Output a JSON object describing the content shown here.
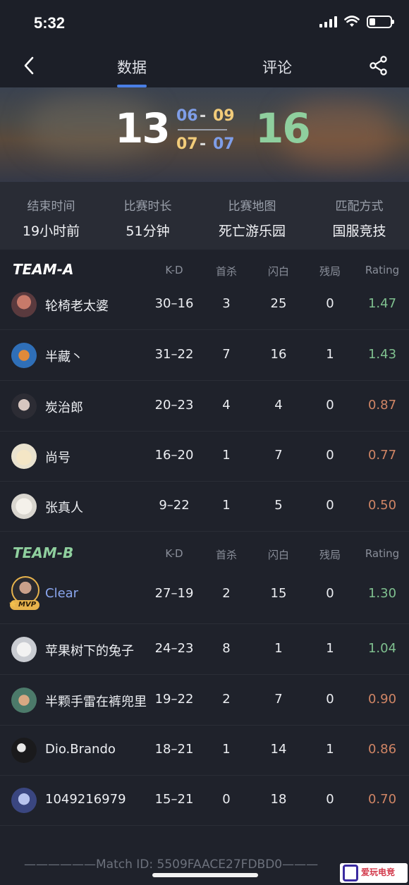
{
  "status": {
    "time": "5:32"
  },
  "nav": {
    "tab_data": "数据",
    "tab_comment": "评论"
  },
  "score": {
    "left": "13",
    "right": "16",
    "half1": {
      "a": "06",
      "sep": "-",
      "b": "09"
    },
    "half2": {
      "a": "07",
      "sep": "-",
      "b": "07"
    }
  },
  "info": [
    {
      "label": "结束时间",
      "value": "19小时前"
    },
    {
      "label": "比赛时长",
      "value": "51分钟"
    },
    {
      "label": "比赛地图",
      "value": "死亡游乐园"
    },
    {
      "label": "匹配方式",
      "value": "国服竞技"
    }
  ],
  "columns": {
    "kd": "K-D",
    "first_kill": "首杀",
    "flash": "闪白",
    "clutch": "残局",
    "rating": "Rating"
  },
  "team_a": {
    "name": "TEAM-A",
    "players": [
      {
        "name": "轮椅老太婆",
        "kd": "30–16",
        "first_kill": "3",
        "flash": "25",
        "clutch": "0",
        "rating": "1.47",
        "rating_color": "#7fc08f"
      },
      {
        "name": "半藏丶",
        "kd": "31–22",
        "first_kill": "7",
        "flash": "16",
        "clutch": "1",
        "rating": "1.43",
        "rating_color": "#7fc08f"
      },
      {
        "name": "炭治郎",
        "kd": "20–23",
        "first_kill": "4",
        "flash": "4",
        "clutch": "0",
        "rating": "0.87",
        "rating_color": "#d08565"
      },
      {
        "name": "尚号",
        "kd": "16–20",
        "first_kill": "1",
        "flash": "7",
        "clutch": "0",
        "rating": "0.77",
        "rating_color": "#d08565"
      },
      {
        "name": "张真人",
        "kd": "9–22",
        "first_kill": "1",
        "flash": "5",
        "clutch": "0",
        "rating": "0.50",
        "rating_color": "#d08565"
      }
    ]
  },
  "team_b": {
    "name": "TEAM-B",
    "players": [
      {
        "name": "Clear",
        "kd": "27–19",
        "first_kill": "2",
        "flash": "15",
        "clutch": "0",
        "rating": "1.30",
        "rating_color": "#7fc08f",
        "mvp": "MVP"
      },
      {
        "name": "苹果树下的兔子",
        "kd": "24–23",
        "first_kill": "8",
        "flash": "1",
        "clutch": "1",
        "rating": "1.04",
        "rating_color": "#7fc08f"
      },
      {
        "name": "半颗手雷在裤兜里",
        "kd": "19–22",
        "first_kill": "2",
        "flash": "7",
        "clutch": "0",
        "rating": "0.90",
        "rating_color": "#d08565"
      },
      {
        "name": "Dio.Brando",
        "kd": "18–21",
        "first_kill": "1",
        "flash": "14",
        "clutch": "1",
        "rating": "0.86",
        "rating_color": "#d08565"
      },
      {
        "name": "1049216979",
        "kd": "15–21",
        "first_kill": "0",
        "flash": "18",
        "clutch": "0",
        "rating": "0.70",
        "rating_color": "#d08565"
      }
    ]
  },
  "footer": {
    "match_id": "——————Match ID: 5509FAACE27FDBD0———",
    "watermark": "爱玩电竞"
  }
}
